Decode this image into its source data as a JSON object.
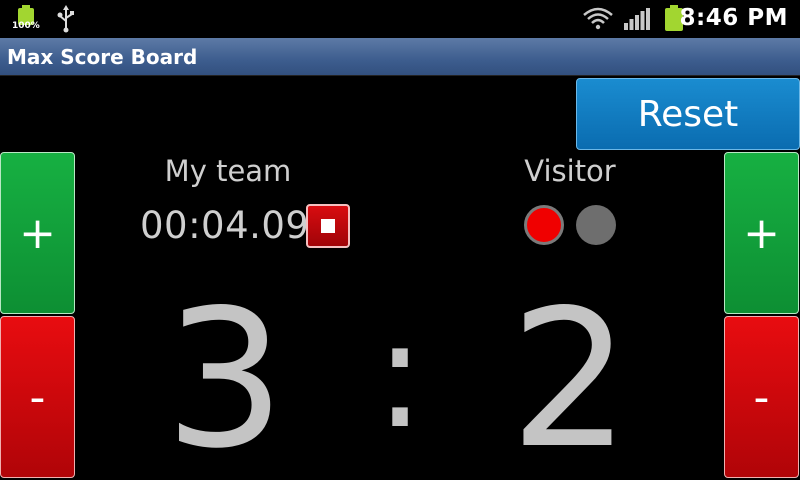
{
  "status_bar": {
    "battery_percent": "100%",
    "time": "8:46 PM",
    "icons": [
      "battery-icon",
      "usb-icon",
      "wifi-icon",
      "signal-icon",
      "battery-icon"
    ]
  },
  "app": {
    "title": "Max Score Board"
  },
  "controls": {
    "reset_label": "Reset",
    "plus_label": "+",
    "minus_label": "-"
  },
  "home": {
    "name": "My team",
    "score": "3"
  },
  "visitor": {
    "name": "Visitor",
    "score": "2"
  },
  "timer": {
    "value": "00:04.09"
  },
  "separator": ":",
  "colors": {
    "plus_green": "#12a03c",
    "minus_red": "#d00a0e",
    "reset_blue": "#0a7cc0",
    "indicator_active": "#f00000",
    "indicator_inactive": "#6e6e6e",
    "titlebar": "#3d5d8e"
  }
}
